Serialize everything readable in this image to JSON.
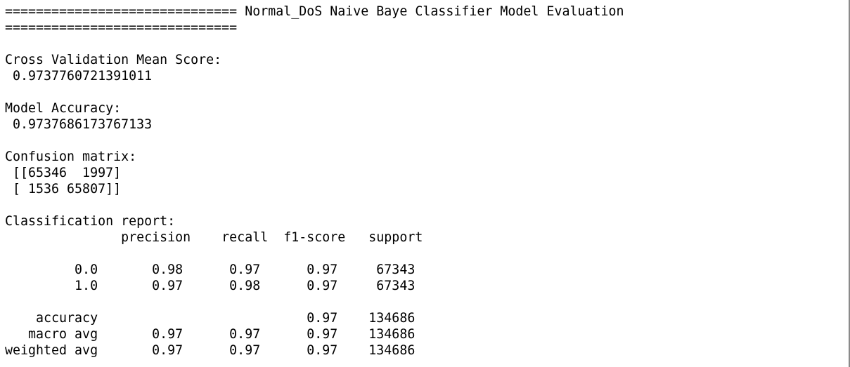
{
  "report": {
    "lines": [
      "============================== Normal_DoS Naive Baye Classifier Model Evaluation",
      "==============================",
      "",
      "Cross Validation Mean Score:",
      " 0.9737760721391011",
      "",
      "Model Accuracy:",
      " 0.9737686173767133",
      "",
      "Confusion matrix:",
      " [[65346  1997]",
      " [ 1536 65807]]",
      "",
      "Classification report:",
      "               precision    recall  f1-score   support",
      "",
      "         0.0       0.98      0.97      0.97     67343",
      "         1.0       0.97      0.98      0.97     67343",
      "",
      "    accuracy                           0.97    134686",
      "   macro avg       0.97      0.97      0.97    134686",
      "weighted avg       0.97      0.97      0.97    134686"
    ]
  }
}
